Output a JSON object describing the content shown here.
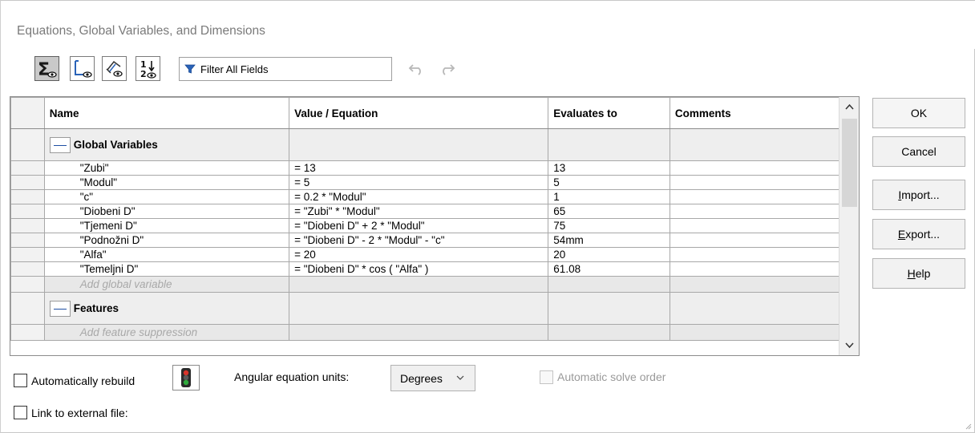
{
  "window": {
    "title": "Equations, Global Variables, and Dimensions"
  },
  "toolbar": {
    "buttons": [
      {
        "icon": "equations-view-icon",
        "active": true
      },
      {
        "icon": "sketch-equations-view-icon",
        "active": false
      },
      {
        "icon": "dimensions-view-icon",
        "active": false
      },
      {
        "icon": "ordered-view-icon",
        "active": false
      }
    ],
    "filter": {
      "placeholder": "Filter All Fields",
      "value": ""
    },
    "undo_icon": "undo-icon",
    "redo_icon": "redo-icon"
  },
  "grid": {
    "columns": [
      "Name",
      "Value / Equation",
      "Evaluates to",
      "Comments"
    ],
    "groups": [
      {
        "label": "Global Variables",
        "rows": [
          {
            "name": "\"Zubi\"",
            "value": "= 13",
            "evaluates": "13",
            "comments": ""
          },
          {
            "name": "\"Modul\"",
            "value": "= 5",
            "evaluates": "5",
            "comments": ""
          },
          {
            "name": "\"c\"",
            "value": "= 0.2 * \"Modul\"",
            "evaluates": "1",
            "comments": ""
          },
          {
            "name": "\"Diobeni D\"",
            "value": "= \"Zubi\" * \"Modul\"",
            "evaluates": "65",
            "comments": ""
          },
          {
            "name": "\"Tjemeni D\"",
            "value": "= \"Diobeni D\" + 2 * \"Modul\"",
            "evaluates": "75",
            "comments": ""
          },
          {
            "name": "\"Podnožni D\"",
            "value": "= \"Diobeni D\" - 2 * \"Modul\" - \"c\"",
            "evaluates": "54mm",
            "comments": ""
          },
          {
            "name": "\"Alfa\"",
            "value": "= 20",
            "evaluates": "20",
            "comments": ""
          },
          {
            "name": "\"Temeljni D\"",
            "value": "= \"Diobeni D\" * cos ( \"Alfa\" )",
            "evaluates": "61.08",
            "comments": ""
          }
        ],
        "add_row": "Add global variable"
      },
      {
        "label": "Features",
        "rows": [],
        "add_row": "Add feature suppression"
      }
    ]
  },
  "side_buttons": {
    "ok": "OK",
    "cancel": "Cancel",
    "import": "Import...",
    "export": "Export...",
    "help": "Help"
  },
  "bottom": {
    "auto_rebuild": {
      "label": "Automatically rebuild",
      "checked": false
    },
    "rebuild_icon": "traffic-light-icon",
    "angular_units": {
      "label": "Angular equation units:",
      "value": "Degrees"
    },
    "auto_solve": {
      "label": "Automatic solve order",
      "checked": false,
      "enabled": false
    },
    "link_external": {
      "label": "Link to external file:",
      "checked": false
    }
  }
}
